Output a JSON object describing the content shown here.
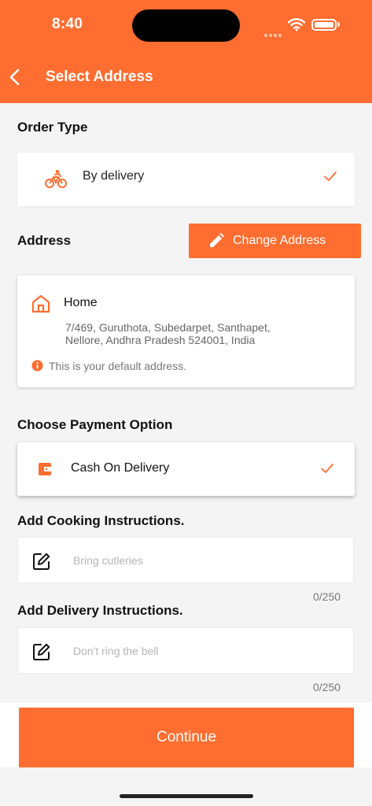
{
  "status": {
    "time": "8:40"
  },
  "header": {
    "title": "Select Address"
  },
  "order_type": {
    "label": "Order Type",
    "option": "By delivery"
  },
  "address": {
    "label": "Address",
    "change_button": "Change Address",
    "name": "Home",
    "line1": "7/469, Guruthota, Subedarpet, Santhapet,",
    "line2": "Nellore, Andhra Pradesh 524001, India",
    "default_note": "This is your default address."
  },
  "payment": {
    "label": "Choose Payment Option",
    "option": "Cash On Delivery"
  },
  "cooking": {
    "label": "Add Cooking Instructions.",
    "placeholder": "Bring cutleries",
    "counter": "0/250"
  },
  "delivery": {
    "label": "Add Delivery Instructions.",
    "placeholder": "Don't ring the bell",
    "counter": "0/250"
  },
  "footer": {
    "continue_label": "Continue"
  },
  "colors": {
    "accent": "#FF6D30",
    "background": "#F4F4F4",
    "card": "#FFFFFF"
  },
  "icons": [
    "back-arrow-icon",
    "bike-icon",
    "check-icon",
    "pencil-icon",
    "home-icon",
    "info-icon",
    "wallet-icon",
    "edit-icon",
    "wifi-icon",
    "battery-icon"
  ]
}
